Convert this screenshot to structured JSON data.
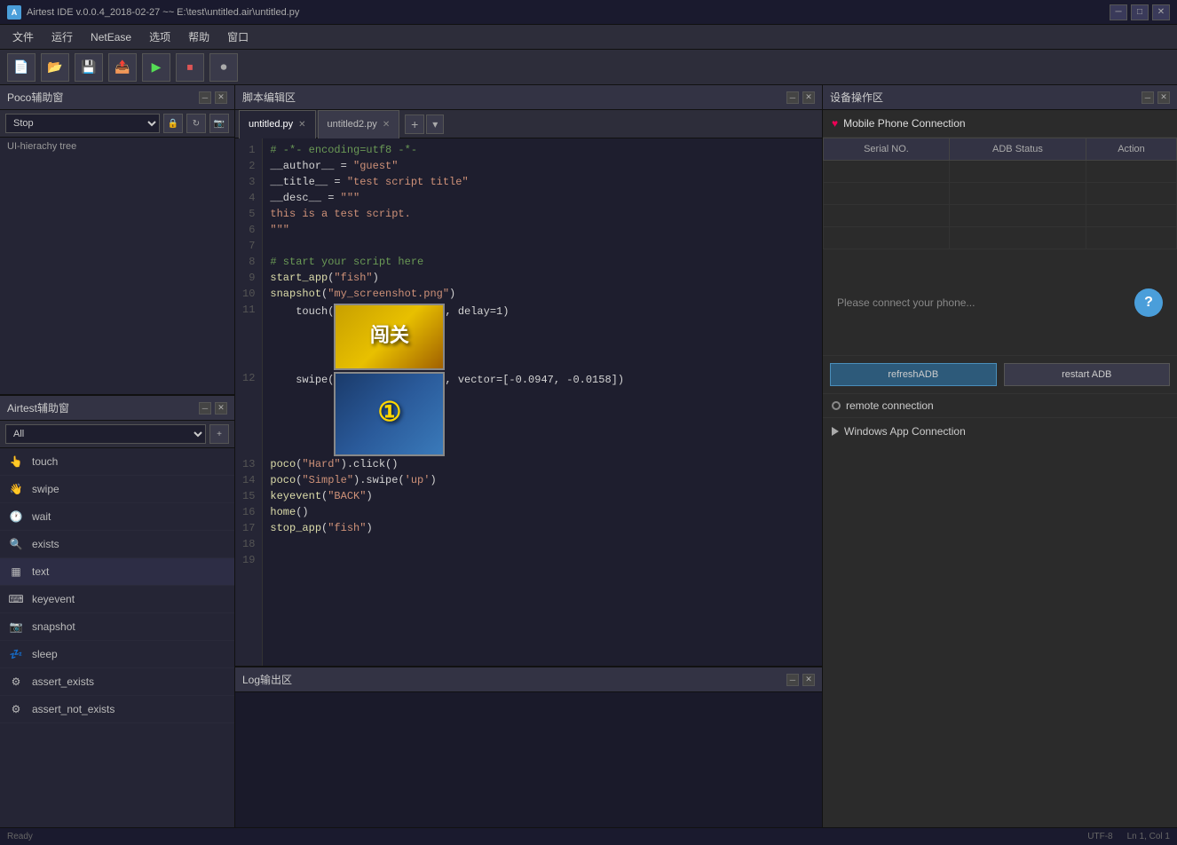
{
  "titlebar": {
    "title": "Airtest IDE v.0.0.4_2018-02-27 ~~ E:\\test\\untitled.air\\untitled.py",
    "icon_label": "A"
  },
  "menu": {
    "items": [
      "文件",
      "运行",
      "NetEase",
      "选项",
      "帮助",
      "窗口"
    ]
  },
  "toolbar": {
    "buttons": [
      "new-icon",
      "open-icon",
      "save-icon",
      "export-icon",
      "play-icon",
      "stop-icon",
      "record-icon"
    ]
  },
  "poco_panel": {
    "title": "Poco辅助窗",
    "select_value": "Stop",
    "hierarchy_label": "UI-hierachy tree"
  },
  "airtest_panel": {
    "title": "Airtest辅助窗",
    "filter_value": "All",
    "items": [
      {
        "icon": "touch-icon",
        "label": "touch"
      },
      {
        "icon": "swipe-icon",
        "label": "swipe"
      },
      {
        "icon": "wait-icon",
        "label": "wait"
      },
      {
        "icon": "exists-icon",
        "label": "exists"
      },
      {
        "icon": "text-icon",
        "label": "text"
      },
      {
        "icon": "keyevent-icon",
        "label": "keyevent"
      },
      {
        "icon": "snapshot-icon",
        "label": "snapshot"
      },
      {
        "icon": "sleep-icon",
        "label": "sleep"
      },
      {
        "icon": "assert-exists-icon",
        "label": "assert_exists"
      },
      {
        "icon": "assert-not-exists-icon",
        "label": "assert_not_exists"
      }
    ]
  },
  "editor": {
    "title": "脚本编辑区",
    "tabs": [
      {
        "label": "untitled.py",
        "active": true
      },
      {
        "label": "untitled2.py",
        "active": false
      }
    ],
    "lines": [
      {
        "num": 1,
        "code": "# -*- encoding=utf8 -*-",
        "type": "comment"
      },
      {
        "num": 2,
        "code": "__author__ = \"guest\"",
        "type": "normal"
      },
      {
        "num": 3,
        "code": "__title__ = \"test script title\"",
        "type": "normal"
      },
      {
        "num": 4,
        "code": "__desc__ = \"\"\"",
        "type": "normal"
      },
      {
        "num": 5,
        "code": "this is a test script.",
        "type": "normal"
      },
      {
        "num": 6,
        "code": "\"\"\"",
        "type": "normal"
      },
      {
        "num": 7,
        "code": "",
        "type": "normal"
      },
      {
        "num": 8,
        "code": "# start your script here",
        "type": "comment"
      },
      {
        "num": 9,
        "code": "start_app(\"fish\")",
        "type": "normal"
      },
      {
        "num": 10,
        "code": "snapshot(\"my_screenshot.png\")",
        "type": "normal"
      },
      {
        "num": 11,
        "code": "image1",
        "type": "image1"
      },
      {
        "num": 12,
        "code": "image2",
        "type": "image2"
      },
      {
        "num": 13,
        "code": "poco(\"Hard\").click()",
        "type": "normal"
      },
      {
        "num": 14,
        "code": "poco(\"Simple\").swipe('up')",
        "type": "normal"
      },
      {
        "num": 15,
        "code": "keyevent(\"BACK\")",
        "type": "normal"
      },
      {
        "num": 16,
        "code": "home()",
        "type": "normal"
      },
      {
        "num": 17,
        "code": "stop_app(\"fish\")",
        "type": "normal"
      },
      {
        "num": 18,
        "code": "",
        "type": "normal"
      },
      {
        "num": 19,
        "code": "",
        "type": "normal"
      }
    ],
    "touch_line": "    touch(",
    "touch_end": ", delay=1)",
    "swipe_line": "    swipe(",
    "swipe_end": ", vector=[-0.0947, -0.0158])"
  },
  "log_area": {
    "title": "Log输出区"
  },
  "device_panel": {
    "title": "设备操作区",
    "mobile_section": {
      "title": "Mobile Phone Connection",
      "table_headers": [
        "Serial NO.",
        "ADB Status",
        "Action"
      ],
      "please_text": "Please connect your phone...",
      "refresh_btn": "refreshADB",
      "restart_btn": "restart ADB",
      "remote_label": "remote connection"
    },
    "windows_section": {
      "title": "Windows App Connection"
    }
  },
  "colors": {
    "bg_dark": "#1e1e2e",
    "bg_mid": "#252535",
    "bg_light": "#2d2d3a",
    "accent": "#4a9eda",
    "border": "#444"
  }
}
